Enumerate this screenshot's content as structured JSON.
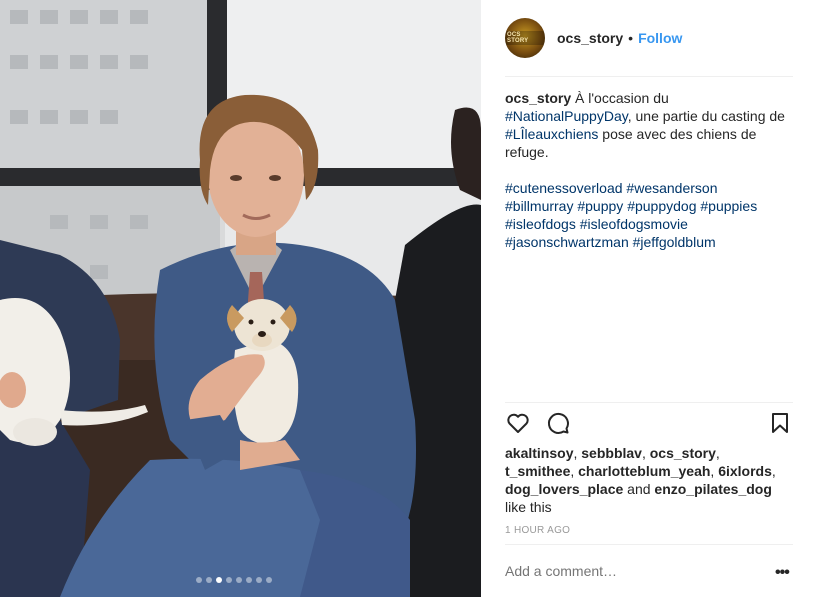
{
  "post": {
    "username": "ocs_story",
    "separator": "•",
    "follow_label": "Follow",
    "avatar_text": "OCS STORY",
    "caption": {
      "username": "ocs_story",
      "text_1": " À l'occasion du ",
      "tag_1": "#NationalPuppyDay",
      "text_2": ", une partie du casting de ",
      "tag_2": "#LÎleauxchiens",
      "text_3": " pose avec des chiens de refuge.",
      "hashtags": [
        "#cutenessoverload",
        "#wesanderson",
        "#billmurray",
        "#puppy",
        "#puppydog",
        "#puppies",
        "#isleofdogs",
        "#isleofdogsmovie",
        "#jasonschwartzman",
        "#jeffgoldblum"
      ]
    },
    "likes": {
      "users": [
        "akaltinsoy",
        "sebbblav",
        "ocs_story",
        "t_smithee",
        "charlotteblum_yeah",
        "6ixlords",
        "dog_lovers_place"
      ],
      "and": " and ",
      "last_user": "enzo_pilates_dog",
      "suffix": "like this"
    },
    "timestamp": "1 HOUR AGO",
    "comment_placeholder": "Add a comment…",
    "more_label": "•••",
    "carousel": {
      "count": 8,
      "active_index": 2
    }
  },
  "icons": {
    "like": "heart-icon",
    "comment": "comment-bubble-icon",
    "save": "bookmark-icon"
  }
}
